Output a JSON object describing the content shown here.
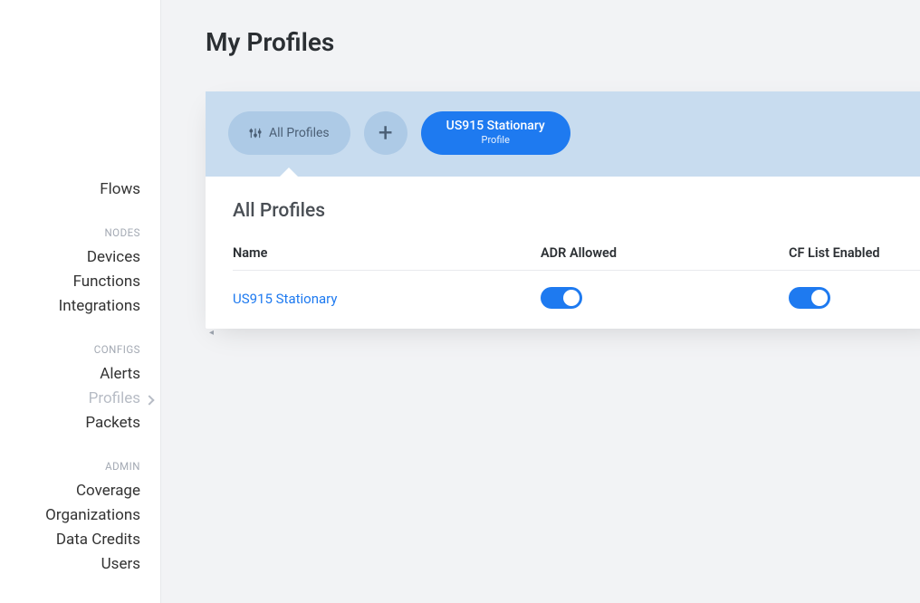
{
  "sidebar": {
    "top_item": "Flows",
    "sections": [
      {
        "heading": "NODES",
        "items": [
          {
            "label": "Devices",
            "active": false
          },
          {
            "label": "Functions",
            "active": false
          },
          {
            "label": "Integrations",
            "active": false
          }
        ]
      },
      {
        "heading": "CONFIGS",
        "items": [
          {
            "label": "Alerts",
            "active": false
          },
          {
            "label": "Profiles",
            "active": true
          },
          {
            "label": "Packets",
            "active": false
          }
        ]
      },
      {
        "heading": "ADMIN",
        "items": [
          {
            "label": "Coverage",
            "active": false
          },
          {
            "label": "Organizations",
            "active": false
          },
          {
            "label": "Data Credits",
            "active": false
          },
          {
            "label": "Users",
            "active": false
          }
        ]
      }
    ]
  },
  "page": {
    "title": "My Profiles"
  },
  "tabs": {
    "all_label": "All Profiles",
    "profile_pill": {
      "title": "US915 Stationary",
      "subtitle": "Profile"
    }
  },
  "profiles_section": {
    "title": "All Profiles",
    "columns": {
      "name": "Name",
      "adr": "ADR Allowed",
      "cf": "CF List Enabled"
    },
    "rows": [
      {
        "name": "US915 Stationary",
        "adr": true,
        "cf": true
      }
    ]
  },
  "colors": {
    "accent": "#1e7af0",
    "tabs_bg": "#c8dcef",
    "pill_muted": "#adcae6"
  },
  "icons": {
    "sliders": "sliders-icon",
    "plus": "plus-icon",
    "chevron_right": "chevron-right-icon",
    "scroll_left": "scroll-left-icon"
  }
}
